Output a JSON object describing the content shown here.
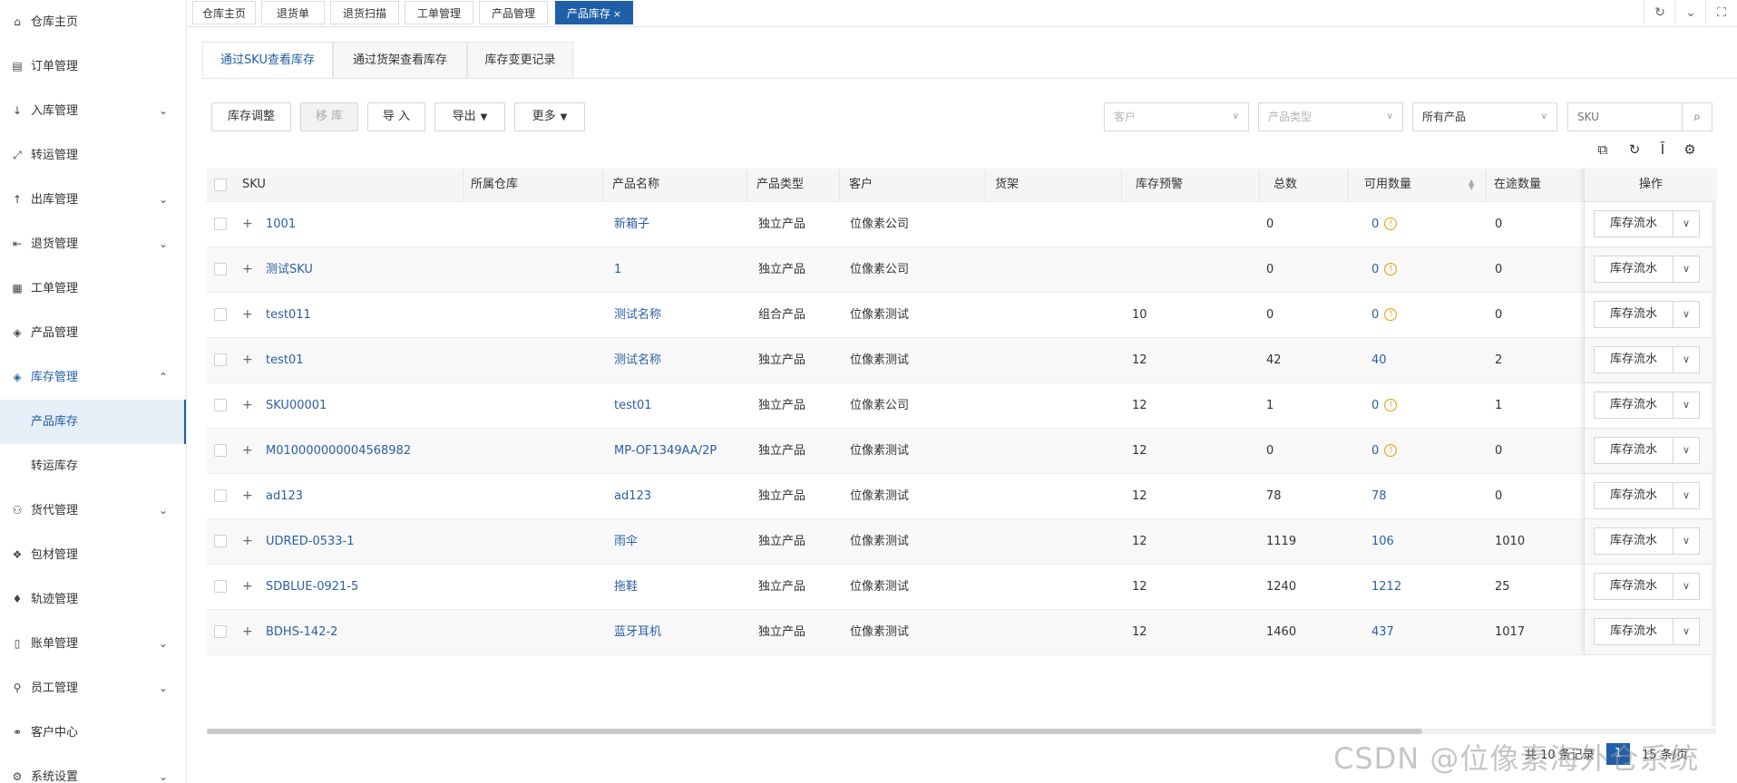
{
  "sidebar": {
    "items": [
      {
        "label": "仓库主页"
      },
      {
        "label": "订单管理"
      },
      {
        "label": "入库管理",
        "caret": "⌄"
      },
      {
        "label": "转运管理"
      },
      {
        "label": "出库管理",
        "caret": "⌄"
      },
      {
        "label": "退货管理",
        "caret": "⌄"
      },
      {
        "label": "工单管理"
      },
      {
        "label": "产品管理"
      },
      {
        "label": "库存管理",
        "caret": "⌃"
      },
      {
        "label": "货代管理",
        "caret": "⌄"
      },
      {
        "label": "包材管理"
      },
      {
        "label": "轨迹管理"
      },
      {
        "label": "账单管理",
        "caret": "⌄"
      },
      {
        "label": "员工管理",
        "caret": "⌄"
      },
      {
        "label": "客户中心"
      },
      {
        "label": "系统设置",
        "caret": "⌄"
      }
    ],
    "sub_items": [
      {
        "label": "产品库存"
      },
      {
        "label": "转运库存"
      }
    ]
  },
  "page_tabs": [
    {
      "label": "仓库主页"
    },
    {
      "label": "退货单"
    },
    {
      "label": "退货扫描"
    },
    {
      "label": "工单管理"
    },
    {
      "label": "产品管理"
    },
    {
      "label": "产品库存",
      "close": "×"
    }
  ],
  "sub_tabs": [
    {
      "label": "通过SKU查看库存"
    },
    {
      "label": "通过货架查看库存"
    },
    {
      "label": "库存变更记录"
    }
  ],
  "toolbar": {
    "adjust": "库存调整",
    "move": "移 库",
    "import": "导 入",
    "export": "导出",
    "more": "更多"
  },
  "filters": {
    "customer": "客户",
    "product_type": "产品类型",
    "product_scope": "所有产品",
    "sku_placeholder": "SKU"
  },
  "table": {
    "headers": {
      "sku": "SKU",
      "warehouse": "所属仓库",
      "name": "产品名称",
      "type": "产品类型",
      "customer": "客户",
      "shelf": "货架",
      "alert": "库存预警",
      "total": "总数",
      "available": "可用数量",
      "transit": "在途数量",
      "ops": "操作"
    },
    "rows": [
      {
        "sku": "1001",
        "name": "新箱子",
        "type": "独立产品",
        "customer": "位像素公司",
        "alert": "",
        "total": "0",
        "available": "0",
        "warn": "!",
        "transit": "0",
        "op": "库存流水"
      },
      {
        "sku": "测试SKU",
        "name": "1",
        "type": "独立产品",
        "customer": "位像素公司",
        "alert": "",
        "total": "0",
        "available": "0",
        "warn": "!",
        "transit": "0",
        "op": "库存流水"
      },
      {
        "sku": "test011",
        "name": "测试名称",
        "type": "组合产品",
        "customer": "位像素测试",
        "alert": "10",
        "total": "0",
        "available": "0",
        "warn": "!",
        "transit": "0",
        "op": "库存流水"
      },
      {
        "sku": "test01",
        "name": "测试名称",
        "type": "独立产品",
        "customer": "位像素测试",
        "alert": "12",
        "total": "42",
        "available": "40",
        "transit": "2",
        "op": "库存流水"
      },
      {
        "sku": "SKU00001",
        "name": "test01",
        "type": "独立产品",
        "customer": "位像素公司",
        "alert": "12",
        "total": "1",
        "available": "0",
        "warn": "!",
        "transit": "1",
        "op": "库存流水"
      },
      {
        "sku": "M010000000004568982",
        "name": "MP-OF1349AA/2P",
        "type": "独立产品",
        "customer": "位像素测试",
        "alert": "12",
        "total": "0",
        "available": "0",
        "warn": "!",
        "transit": "0",
        "op": "库存流水"
      },
      {
        "sku": "ad123",
        "name": "ad123",
        "type": "独立产品",
        "customer": "位像素测试",
        "alert": "12",
        "total": "78",
        "available": "78",
        "transit": "0",
        "op": "库存流水"
      },
      {
        "sku": "UDRED-0533-1",
        "name": "雨伞",
        "type": "独立产品",
        "customer": "位像素测试",
        "alert": "12",
        "total": "1119",
        "available": "106",
        "transit": "1010",
        "op": "库存流水"
      },
      {
        "sku": "SDBLUE-0921-5",
        "name": "拖鞋",
        "type": "独立产品",
        "customer": "位像素测试",
        "alert": "12",
        "total": "1240",
        "available": "1212",
        "transit": "25",
        "op": "库存流水"
      },
      {
        "sku": "BDHS-142-2",
        "name": "蓝牙耳机",
        "type": "独立产品",
        "customer": "位像素测试",
        "alert": "12",
        "total": "1460",
        "available": "437",
        "transit": "1017",
        "op": "库存流水"
      }
    ]
  },
  "footer": {
    "total_text": "共 10 条记录",
    "page": "1",
    "page_size": "15 条/页"
  },
  "watermark": "CSDN @位像素海外仓系统",
  "colors": {
    "accent": "#1f5fa8",
    "link": "#2b5fa5",
    "warning": "#e0a100"
  }
}
